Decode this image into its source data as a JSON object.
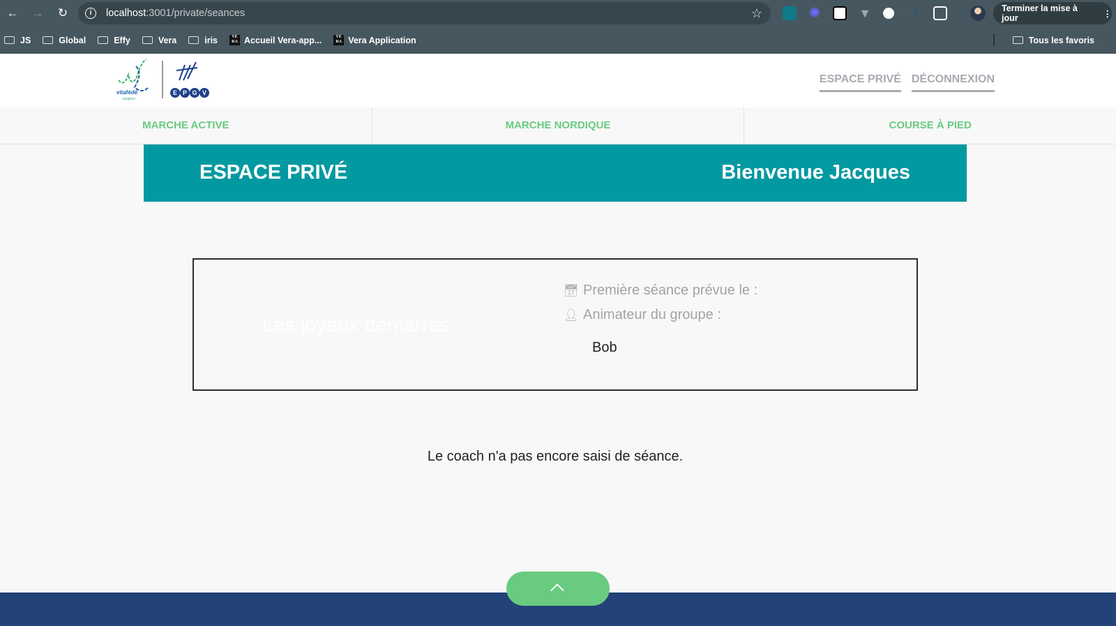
{
  "browser": {
    "url_host": "localhost",
    "url_path": ":3001/private/seances",
    "update_label": "Terminer la mise à jour",
    "bookmarks": [
      {
        "label": "JS",
        "icon": "folder-icon"
      },
      {
        "label": "Global",
        "icon": "folder-icon"
      },
      {
        "label": "Effy",
        "icon": "folder-icon"
      },
      {
        "label": "Vera",
        "icon": "folder-icon"
      },
      {
        "label": "iris",
        "icon": "folder-icon"
      },
      {
        "label": "Accueil Vera-app...",
        "icon": "vera-icon"
      },
      {
        "label": "Vera Application",
        "icon": "vera-icon"
      }
    ],
    "all_bookmarks": "Tous les favoris",
    "vera_icon_text": "VERA"
  },
  "header": {
    "logo_text": "vitafédé oxygène",
    "logo2_text": "EPGV",
    "links": [
      "ESPACE PRIVÉ",
      "DÉCONNEXION"
    ]
  },
  "menu": [
    "MARCHE ACTIVE",
    "MARCHE NORDIQUE",
    "COURSE À PIED"
  ],
  "banner": {
    "title": "ESPACE PRIVÉ",
    "welcome": "Bienvenue Jacques"
  },
  "group": {
    "name": "Les joyeux demarrés",
    "first_session_label": "Première séance prévue le :",
    "animator_label": "Animateur du groupe :",
    "animator": "Bob"
  },
  "empty_message": "Le coach n'a pas encore saisi de séance.",
  "colors": {
    "accent": "#0399a1",
    "green": "#68cb7f",
    "footer": "#224278"
  }
}
